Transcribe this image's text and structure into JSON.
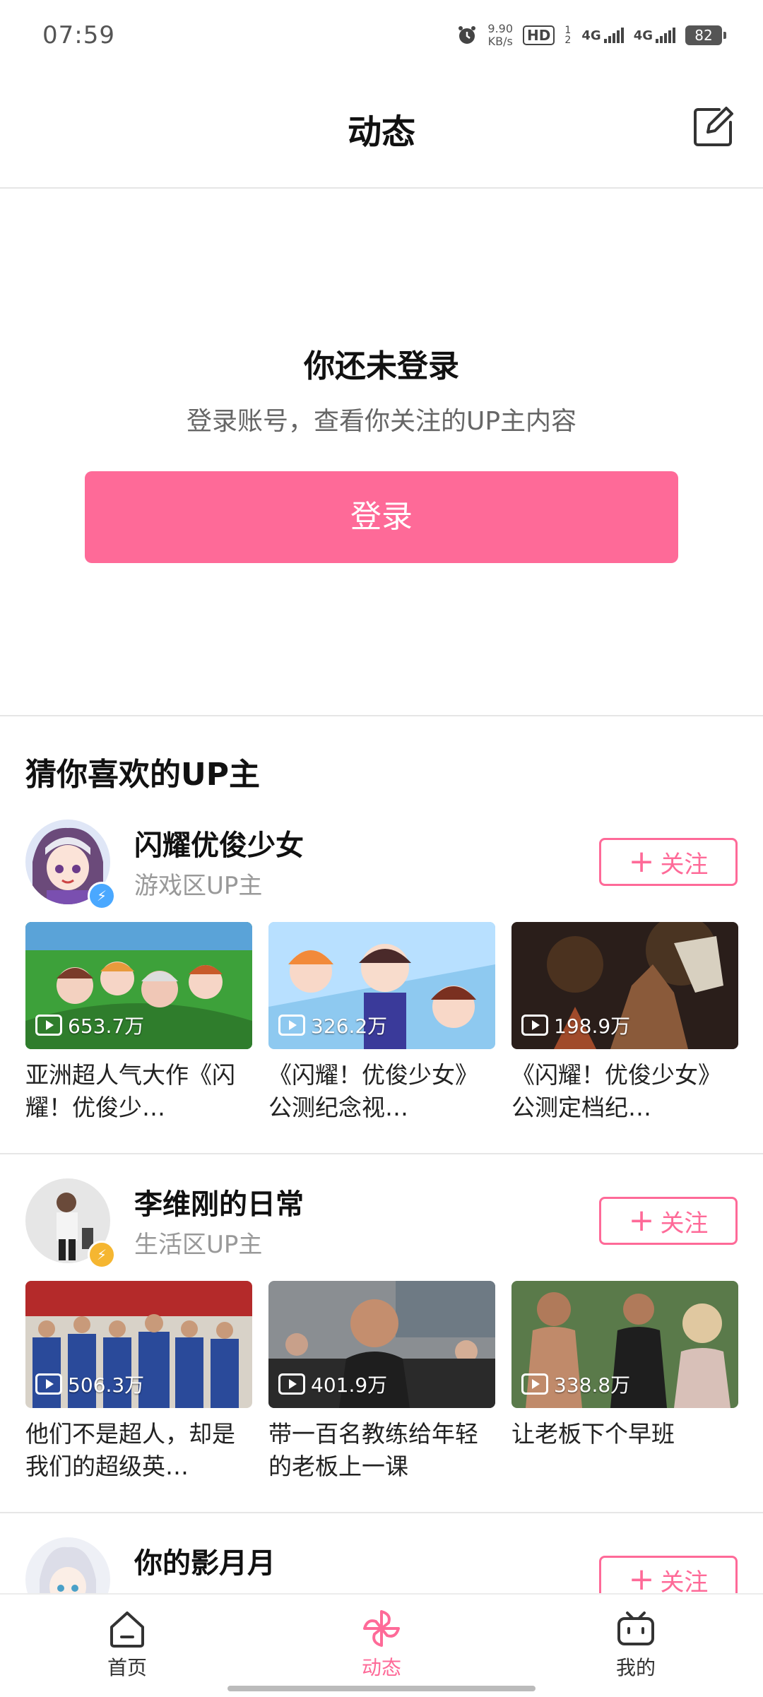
{
  "status_bar": {
    "time": "07:59",
    "speed_value": "9.90",
    "speed_unit": "KB/s",
    "hd": "HD",
    "hd_sub": "1 2",
    "net1": "4G",
    "net2": "4G",
    "battery": "82"
  },
  "header": {
    "title": "动态"
  },
  "login": {
    "title": "你还未登录",
    "subtitle": "登录账号，查看你关注的UP主内容",
    "button_label": "登录"
  },
  "recommend": {
    "title": "猜你喜欢的UP主",
    "follow_label": "关注",
    "ups": [
      {
        "name": "闪耀优俊少女",
        "category": "游戏区UP主",
        "videos": [
          {
            "views": "653.7万",
            "title": "亚洲超人气大作《闪耀！优俊少…"
          },
          {
            "views": "326.2万",
            "title": "《闪耀！优俊少女》公测纪念视…"
          },
          {
            "views": "198.9万",
            "title": "《闪耀！优俊少女》公测定档纪…"
          }
        ]
      },
      {
        "name": "李维刚的日常",
        "category": "生活区UP主",
        "videos": [
          {
            "views": "506.3万",
            "title": "他们不是超人，却是我们的超级英…"
          },
          {
            "views": "401.9万",
            "title": "带一百名教练给年轻的老板上一课"
          },
          {
            "views": "338.8万",
            "title": "让老板下个早班"
          }
        ]
      },
      {
        "name": "你的影月月",
        "category": "",
        "videos": []
      }
    ]
  },
  "bottom_nav": {
    "items": [
      {
        "label": "首页",
        "icon": "home-icon",
        "active": false
      },
      {
        "label": "动态",
        "icon": "pinwheel-icon",
        "active": true
      },
      {
        "label": "我的",
        "icon": "tv-icon",
        "active": false
      }
    ]
  },
  "colors": {
    "accent": "#fe6a98",
    "divider": "#e6e6e6"
  }
}
